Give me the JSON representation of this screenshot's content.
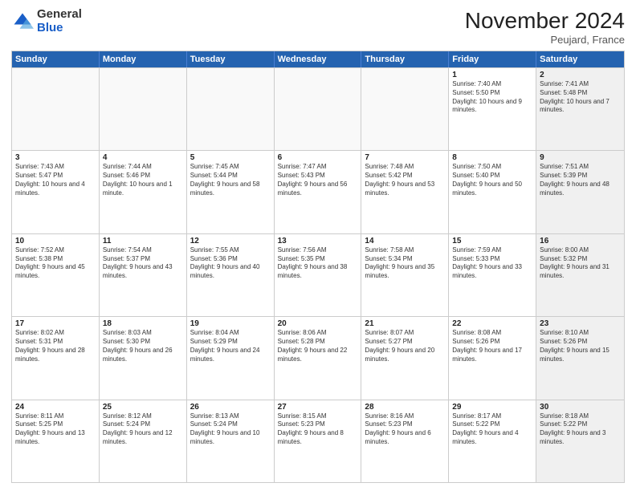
{
  "logo": {
    "general": "General",
    "blue": "Blue"
  },
  "header": {
    "month": "November 2024",
    "location": "Peujard, France"
  },
  "weekdays": [
    "Sunday",
    "Monday",
    "Tuesday",
    "Wednesday",
    "Thursday",
    "Friday",
    "Saturday"
  ],
  "rows": [
    [
      {
        "day": "",
        "info": "",
        "empty": true
      },
      {
        "day": "",
        "info": "",
        "empty": true
      },
      {
        "day": "",
        "info": "",
        "empty": true
      },
      {
        "day": "",
        "info": "",
        "empty": true
      },
      {
        "day": "",
        "info": "",
        "empty": true
      },
      {
        "day": "1",
        "info": "Sunrise: 7:40 AM\nSunset: 5:50 PM\nDaylight: 10 hours and 9 minutes.",
        "shaded": false
      },
      {
        "day": "2",
        "info": "Sunrise: 7:41 AM\nSunset: 5:48 PM\nDaylight: 10 hours and 7 minutes.",
        "shaded": true
      }
    ],
    [
      {
        "day": "3",
        "info": "Sunrise: 7:43 AM\nSunset: 5:47 PM\nDaylight: 10 hours and 4 minutes.",
        "shaded": false
      },
      {
        "day": "4",
        "info": "Sunrise: 7:44 AM\nSunset: 5:46 PM\nDaylight: 10 hours and 1 minute.",
        "shaded": false
      },
      {
        "day": "5",
        "info": "Sunrise: 7:45 AM\nSunset: 5:44 PM\nDaylight: 9 hours and 58 minutes.",
        "shaded": false
      },
      {
        "day": "6",
        "info": "Sunrise: 7:47 AM\nSunset: 5:43 PM\nDaylight: 9 hours and 56 minutes.",
        "shaded": false
      },
      {
        "day": "7",
        "info": "Sunrise: 7:48 AM\nSunset: 5:42 PM\nDaylight: 9 hours and 53 minutes.",
        "shaded": false
      },
      {
        "day": "8",
        "info": "Sunrise: 7:50 AM\nSunset: 5:40 PM\nDaylight: 9 hours and 50 minutes.",
        "shaded": false
      },
      {
        "day": "9",
        "info": "Sunrise: 7:51 AM\nSunset: 5:39 PM\nDaylight: 9 hours and 48 minutes.",
        "shaded": true
      }
    ],
    [
      {
        "day": "10",
        "info": "Sunrise: 7:52 AM\nSunset: 5:38 PM\nDaylight: 9 hours and 45 minutes.",
        "shaded": false
      },
      {
        "day": "11",
        "info": "Sunrise: 7:54 AM\nSunset: 5:37 PM\nDaylight: 9 hours and 43 minutes.",
        "shaded": false
      },
      {
        "day": "12",
        "info": "Sunrise: 7:55 AM\nSunset: 5:36 PM\nDaylight: 9 hours and 40 minutes.",
        "shaded": false
      },
      {
        "day": "13",
        "info": "Sunrise: 7:56 AM\nSunset: 5:35 PM\nDaylight: 9 hours and 38 minutes.",
        "shaded": false
      },
      {
        "day": "14",
        "info": "Sunrise: 7:58 AM\nSunset: 5:34 PM\nDaylight: 9 hours and 35 minutes.",
        "shaded": false
      },
      {
        "day": "15",
        "info": "Sunrise: 7:59 AM\nSunset: 5:33 PM\nDaylight: 9 hours and 33 minutes.",
        "shaded": false
      },
      {
        "day": "16",
        "info": "Sunrise: 8:00 AM\nSunset: 5:32 PM\nDaylight: 9 hours and 31 minutes.",
        "shaded": true
      }
    ],
    [
      {
        "day": "17",
        "info": "Sunrise: 8:02 AM\nSunset: 5:31 PM\nDaylight: 9 hours and 28 minutes.",
        "shaded": false
      },
      {
        "day": "18",
        "info": "Sunrise: 8:03 AM\nSunset: 5:30 PM\nDaylight: 9 hours and 26 minutes.",
        "shaded": false
      },
      {
        "day": "19",
        "info": "Sunrise: 8:04 AM\nSunset: 5:29 PM\nDaylight: 9 hours and 24 minutes.",
        "shaded": false
      },
      {
        "day": "20",
        "info": "Sunrise: 8:06 AM\nSunset: 5:28 PM\nDaylight: 9 hours and 22 minutes.",
        "shaded": false
      },
      {
        "day": "21",
        "info": "Sunrise: 8:07 AM\nSunset: 5:27 PM\nDaylight: 9 hours and 20 minutes.",
        "shaded": false
      },
      {
        "day": "22",
        "info": "Sunrise: 8:08 AM\nSunset: 5:26 PM\nDaylight: 9 hours and 17 minutes.",
        "shaded": false
      },
      {
        "day": "23",
        "info": "Sunrise: 8:10 AM\nSunset: 5:26 PM\nDaylight: 9 hours and 15 minutes.",
        "shaded": true
      }
    ],
    [
      {
        "day": "24",
        "info": "Sunrise: 8:11 AM\nSunset: 5:25 PM\nDaylight: 9 hours and 13 minutes.",
        "shaded": false
      },
      {
        "day": "25",
        "info": "Sunrise: 8:12 AM\nSunset: 5:24 PM\nDaylight: 9 hours and 12 minutes.",
        "shaded": false
      },
      {
        "day": "26",
        "info": "Sunrise: 8:13 AM\nSunset: 5:24 PM\nDaylight: 9 hours and 10 minutes.",
        "shaded": false
      },
      {
        "day": "27",
        "info": "Sunrise: 8:15 AM\nSunset: 5:23 PM\nDaylight: 9 hours and 8 minutes.",
        "shaded": false
      },
      {
        "day": "28",
        "info": "Sunrise: 8:16 AM\nSunset: 5:23 PM\nDaylight: 9 hours and 6 minutes.",
        "shaded": false
      },
      {
        "day": "29",
        "info": "Sunrise: 8:17 AM\nSunset: 5:22 PM\nDaylight: 9 hours and 4 minutes.",
        "shaded": false
      },
      {
        "day": "30",
        "info": "Sunrise: 8:18 AM\nSunset: 5:22 PM\nDaylight: 9 hours and 3 minutes.",
        "shaded": true
      }
    ]
  ]
}
